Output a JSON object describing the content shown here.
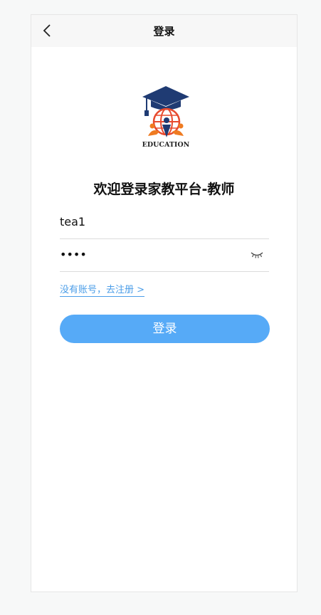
{
  "nav": {
    "title": "登录"
  },
  "logo": {
    "text": "EDUCATION",
    "colors": {
      "navy": "#1f3b73",
      "orange": "#ef7b21",
      "red": "#e74a2e"
    }
  },
  "heading": "欢迎登录家教平台-教师",
  "form": {
    "username_value": "tea1",
    "password_value": "••••"
  },
  "register_link": "没有账号，去注册 >",
  "login_button": "登录",
  "colors": {
    "accent": "#56aaf7",
    "link": "#4c9ee8"
  }
}
